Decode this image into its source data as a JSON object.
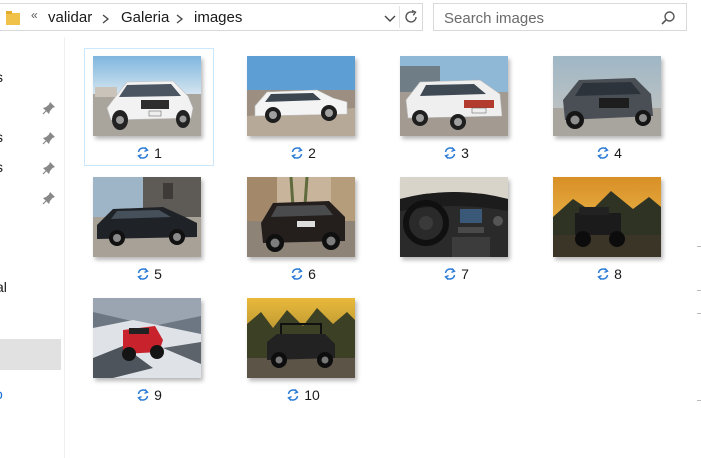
{
  "address_bar": {
    "overflow_chevrons": "«",
    "path": [
      "validar",
      "Galeria",
      "images"
    ]
  },
  "search": {
    "placeholder": "Search images"
  },
  "nav": {
    "items": [
      {
        "label": "s",
        "pinned": false
      },
      {
        "label": "",
        "pinned": true
      },
      {
        "label": "s",
        "pinned": true
      },
      {
        "label": "s",
        "pinned": true
      },
      {
        "label": "",
        "pinned": true
      },
      {
        "label": "al",
        "pinned": false
      }
    ],
    "selected_item": "",
    "onedrive_label": "o"
  },
  "files": [
    {
      "name": "1",
      "selected": true,
      "scene": "white Jeep Cherokee, front view, harbour"
    },
    {
      "name": "2",
      "selected": false,
      "scene": "white Jeep Cherokee, side view, cobblestones"
    },
    {
      "name": "3",
      "selected": false,
      "scene": "white Jeep Cherokee, rear view, harbour"
    },
    {
      "name": "4",
      "selected": false,
      "scene": "dark grey Jeep Cherokee, front view"
    },
    {
      "name": "5",
      "selected": false,
      "scene": "black Jeep Cherokee, side view, city"
    },
    {
      "name": "6",
      "selected": false,
      "scene": "black Jeep Cherokee, rear view, old town"
    },
    {
      "name": "7",
      "selected": false,
      "scene": "Jeep Cherokee interior dashboard"
    },
    {
      "name": "8",
      "selected": false,
      "scene": "black Jeep Wrangler, mountains at sunset"
    },
    {
      "name": "9",
      "selected": false,
      "scene": "red Jeep Wrangler on snowy rocks"
    },
    {
      "name": "10",
      "selected": false,
      "scene": "open-top Jeep Wrangler, autumn forest"
    }
  ],
  "colors": {
    "sync_icon": "#2b7bd6",
    "selection_border": "#cce8ff",
    "nav_selected": "#e1e1e1"
  }
}
